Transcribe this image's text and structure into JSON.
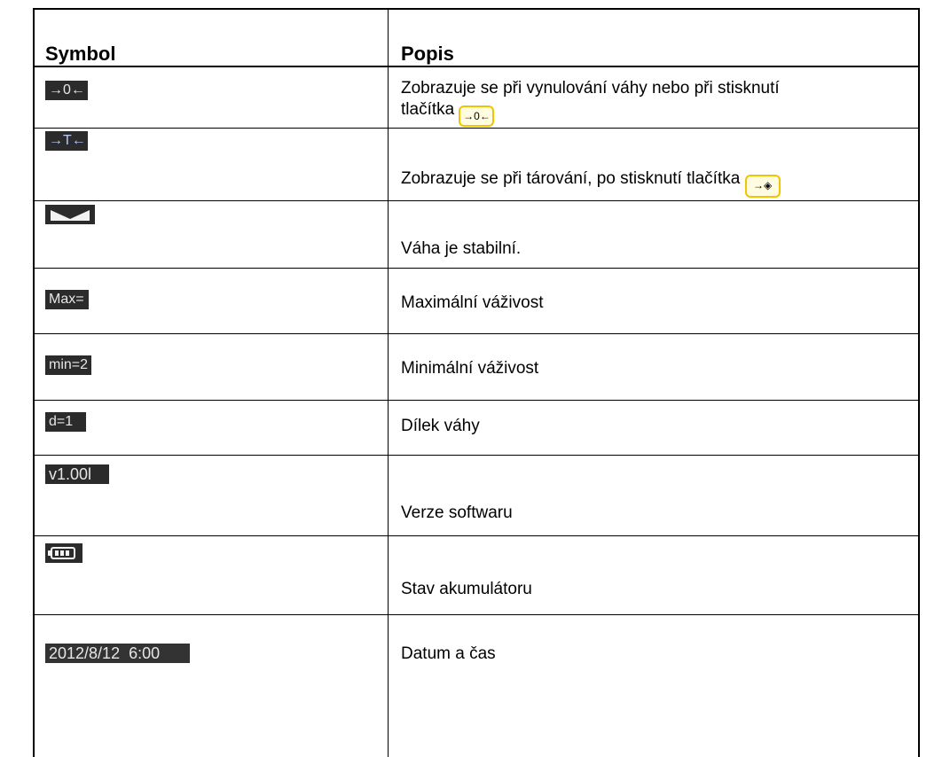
{
  "header": {
    "col_symbol": "Symbol",
    "col_description": "Popis"
  },
  "rows": [
    {
      "symbol": "→0←",
      "text_line1": "Zobrazuje se při vynulování váhy nebo při stisknutí",
      "text_line2": "tlačítka",
      "button_glyph": "→0←"
    },
    {
      "symbol": "→T←",
      "text": "Zobrazuje se při tárování, po stisknutí tlačítka",
      "button_glyph": "→◈"
    },
    {
      "symbol_icon": "stable-indicator-icon",
      "text": "Váha je stabilní."
    },
    {
      "symbol": "Max=",
      "text": "Maximální váživost"
    },
    {
      "symbol": "min=2",
      "text": "Minimální váživost"
    },
    {
      "symbol": "d=1",
      "text": "Dílek váhy"
    },
    {
      "symbol": "v1.00l",
      "text": "Verze softwaru"
    },
    {
      "symbol_icon": "battery-icon",
      "text": "Stav akumulátoru"
    },
    {
      "symbol": "2012/8/12  6:00",
      "text": "Datum a čas"
    }
  ]
}
